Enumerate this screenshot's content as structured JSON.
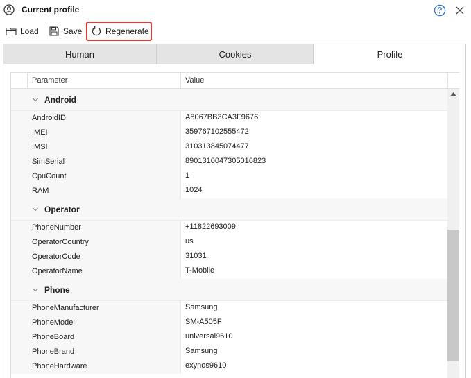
{
  "window": {
    "title": "Current profile"
  },
  "toolbar": {
    "load_label": "Load",
    "save_label": "Save",
    "regenerate_label": "Regenerate"
  },
  "tabs": [
    {
      "label": "Human",
      "active": false
    },
    {
      "label": "Cookies",
      "active": false
    },
    {
      "label": "Profile",
      "active": true
    }
  ],
  "grid": {
    "columns": [
      "Parameter",
      "Value"
    ],
    "groups": [
      {
        "name": "Android",
        "rows": [
          {
            "param": "AndroidID",
            "value": "A8067BB3CA3F9676"
          },
          {
            "param": "IMEI",
            "value": "359767102555472"
          },
          {
            "param": "IMSI",
            "value": "310313845074477"
          },
          {
            "param": "SimSerial",
            "value": "8901310047305016823"
          },
          {
            "param": "CpuCount",
            "value": "1"
          },
          {
            "param": "RAM",
            "value": "1024"
          }
        ]
      },
      {
        "name": "Operator",
        "rows": [
          {
            "param": "PhoneNumber",
            "value": "+11822693009"
          },
          {
            "param": "OperatorCountry",
            "value": "us"
          },
          {
            "param": "OperatorCode",
            "value": "31031"
          },
          {
            "param": "OperatorName",
            "value": "T-Mobile"
          }
        ]
      },
      {
        "name": "Phone",
        "rows": [
          {
            "param": "PhoneManufacturer",
            "value": "Samsung"
          },
          {
            "param": "PhoneModel",
            "value": "SM-A505F"
          },
          {
            "param": "PhoneBoard",
            "value": "universal9610"
          },
          {
            "param": "PhoneBrand",
            "value": "Samsung"
          },
          {
            "param": "PhoneHardware",
            "value": "exynos9610"
          }
        ]
      }
    ]
  },
  "colors": {
    "highlight_border": "#e03a3a",
    "tab_inactive": "#e4e4e4",
    "group_background": "#f7f7f7"
  }
}
